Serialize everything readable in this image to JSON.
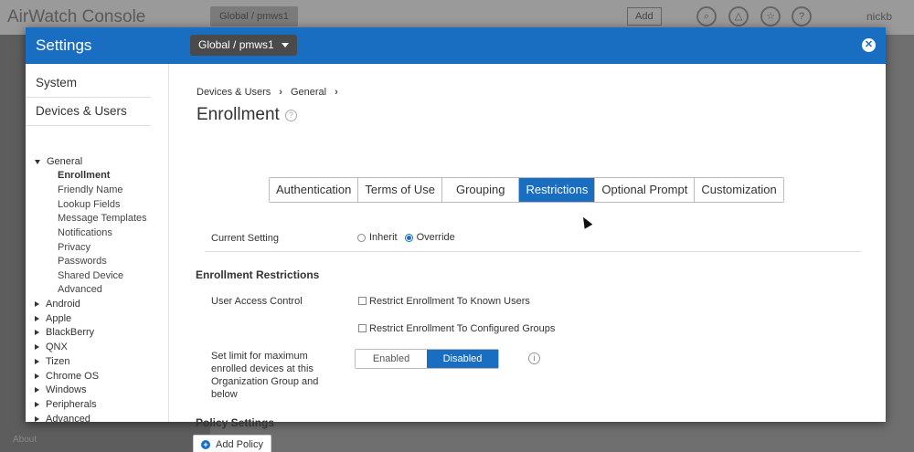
{
  "background": {
    "app_title": "AirWatch Console",
    "org_group": "Global / pmws1",
    "add_label": "Add",
    "user": "nickb",
    "about": "About"
  },
  "modal": {
    "title": "Settings",
    "org_group": "Global / pmws1",
    "close_icon": "close-icon"
  },
  "sidebar": {
    "sections": [
      "System",
      "Devices & Users"
    ],
    "general": {
      "label": "General",
      "items": [
        "Enrollment",
        "Friendly Name",
        "Lookup Fields",
        "Message Templates",
        "Notifications",
        "Privacy",
        "Passwords",
        "Shared Device",
        "Advanced"
      ],
      "active": "Enrollment"
    },
    "collapsed_groups": [
      "Android",
      "Apple",
      "BlackBerry",
      "QNX",
      "Tizen",
      "Chrome OS",
      "Windows",
      "Peripherals",
      "Advanced"
    ]
  },
  "content": {
    "breadcrumb": [
      "Devices & Users",
      "General"
    ],
    "title": "Enrollment",
    "tabs": [
      "Authentication",
      "Terms of Use",
      "Grouping",
      "Restrictions",
      "Optional Prompt",
      "Customization"
    ],
    "active_tab": "Restrictions",
    "current_setting": {
      "label": "Current Setting",
      "options": [
        "Inherit",
        "Override"
      ],
      "selected": "Override"
    },
    "enrollment_restrictions": {
      "heading": "Enrollment Restrictions",
      "user_access_label": "User Access Control",
      "checkboxes": [
        "Restrict Enrollment To Known Users",
        "Restrict Enrollment To Configured Groups"
      ],
      "limit_label": "Set limit for maximum enrolled devices at this Organization Group and below",
      "toggle": [
        "Enabled",
        "Disabled"
      ],
      "toggle_selected": "Disabled"
    },
    "policy_settings": {
      "heading": "Policy Settings",
      "add_button": "Add Policy"
    }
  },
  "colors": {
    "accent": "#1a6ec2",
    "header": "#1a6ec2"
  }
}
